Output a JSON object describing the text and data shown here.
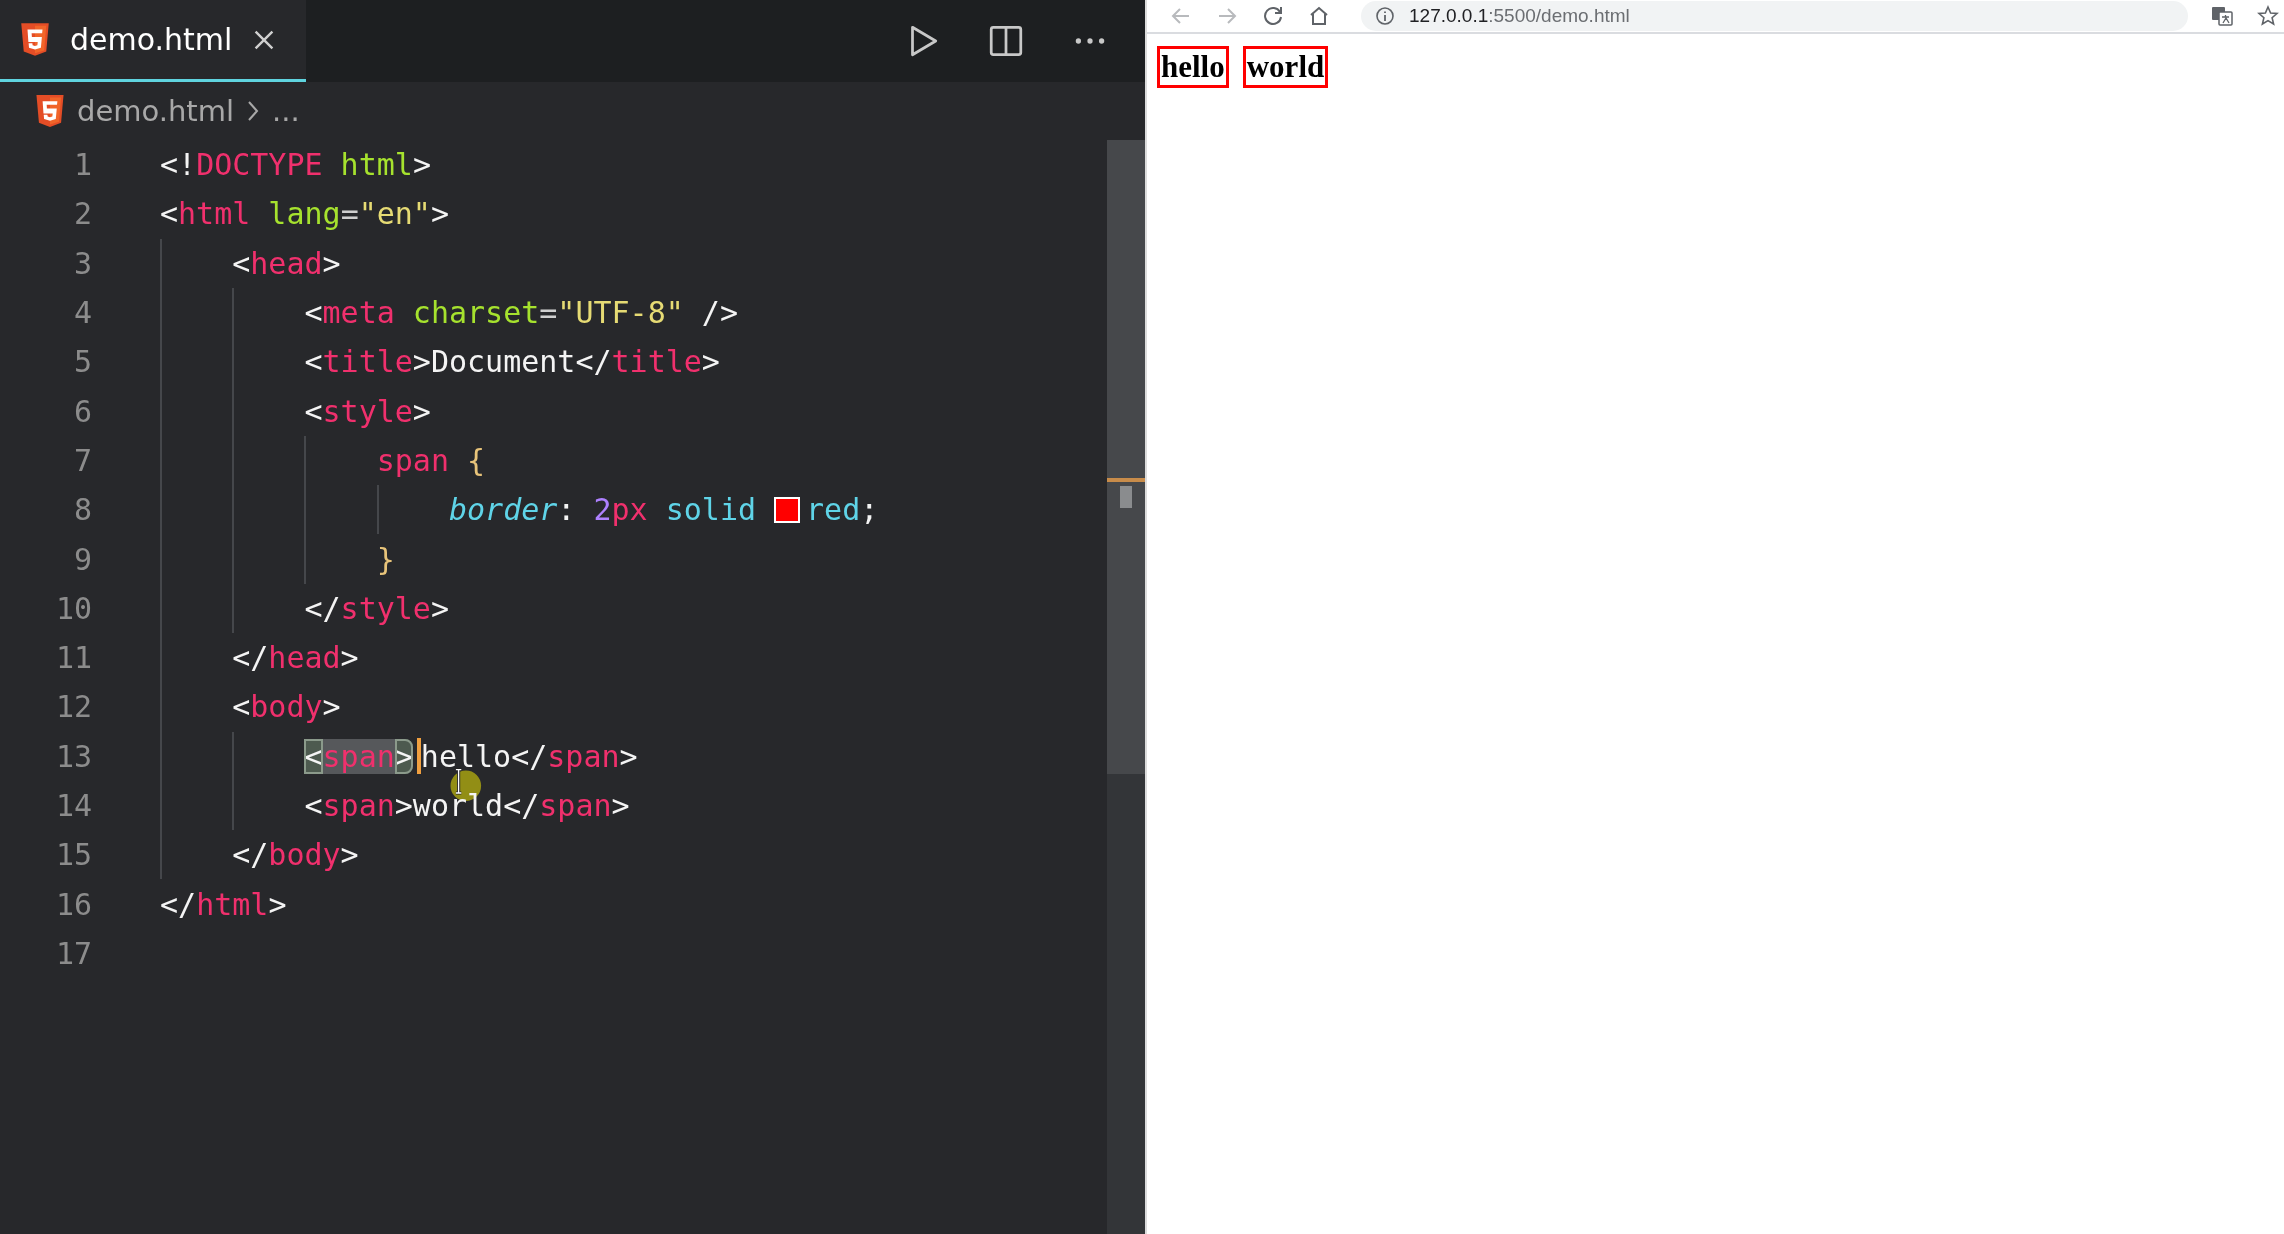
{
  "editor": {
    "tabs": [
      {
        "label": "demo.html",
        "selected": true
      }
    ],
    "breadcrumb": {
      "file": "demo.html",
      "more": "..."
    },
    "lines": [
      {
        "number": "1",
        "tokens": [
          {
            "kind": "punct",
            "text": "<!"
          },
          {
            "kind": "tag",
            "text": "DOCTYPE"
          },
          {
            "kind": "attr",
            "text": " html"
          },
          {
            "kind": "punct",
            "text": ">"
          }
        ]
      },
      {
        "number": "2",
        "tokens": [
          {
            "kind": "punct",
            "text": "<"
          },
          {
            "kind": "tag",
            "text": "html"
          },
          {
            "kind": "attr",
            "text": " lang"
          },
          {
            "kind": "eq",
            "text": "="
          },
          {
            "kind": "string",
            "text": "\"en\""
          },
          {
            "kind": "punct",
            "text": ">"
          }
        ],
        "children": [
          {
            "number": "3",
            "tokens": [
              {
                "kind": "punct",
                "text": "<"
              },
              {
                "kind": "tag",
                "text": "head"
              },
              {
                "kind": "punct",
                "text": ">"
              }
            ],
            "children": [
              {
                "number": "4",
                "tokens": [
                  {
                    "kind": "punct",
                    "text": "<"
                  },
                  {
                    "kind": "tag",
                    "text": "meta"
                  },
                  {
                    "kind": "attr",
                    "text": " charset"
                  },
                  {
                    "kind": "eq",
                    "text": "="
                  },
                  {
                    "kind": "string",
                    "text": "\"UTF-8\""
                  },
                  {
                    "kind": "punct",
                    "text": " />"
                  }
                ]
              },
              {
                "number": "5",
                "tokens": [
                  {
                    "kind": "punct",
                    "text": "<"
                  },
                  {
                    "kind": "tag",
                    "text": "title"
                  },
                  {
                    "kind": "punct",
                    "text": ">"
                  },
                  {
                    "kind": "text",
                    "text": "Document"
                  },
                  {
                    "kind": "punct",
                    "text": "</"
                  },
                  {
                    "kind": "tag",
                    "text": "title"
                  },
                  {
                    "kind": "punct",
                    "text": ">"
                  }
                ]
              },
              {
                "number": "6",
                "tokens": [
                  {
                    "kind": "punct",
                    "text": "<"
                  },
                  {
                    "kind": "tag",
                    "text": "style"
                  },
                  {
                    "kind": "punct",
                    "text": ">"
                  }
                ],
                "children": [
                  {
                    "number": "7",
                    "tokens": [
                      {
                        "kind": "tag",
                        "text": "span"
                      },
                      {
                        "kind": "brace",
                        "text": " {"
                      }
                    ],
                    "children": [
                      {
                        "number": "8",
                        "tokens": [
                          {
                            "kind": "prop",
                            "text": "border"
                          },
                          {
                            "kind": "punct",
                            "text": ": "
                          },
                          {
                            "kind": "num",
                            "text": "2"
                          },
                          {
                            "kind": "tag",
                            "text": "px"
                          },
                          {
                            "kind": "value",
                            "text": " solid"
                          },
                          {
                            "kind": "swatch",
                            "color": "#ff0000"
                          },
                          {
                            "kind": "value",
                            "text": "red"
                          },
                          {
                            "kind": "punct",
                            "text": ";"
                          }
                        ]
                      }
                    ]
                  },
                  {
                    "number": "9",
                    "tokens": [
                      {
                        "kind": "brace",
                        "text": "}"
                      }
                    ]
                  }
                ]
              },
              {
                "number": "10",
                "tokens": [
                  {
                    "kind": "punct",
                    "text": "</"
                  },
                  {
                    "kind": "tag",
                    "text": "style"
                  },
                  {
                    "kind": "punct",
                    "text": ">"
                  }
                ]
              }
            ]
          },
          {
            "number": "11",
            "tokens": [
              {
                "kind": "punct",
                "text": "</"
              },
              {
                "kind": "tag",
                "text": "head"
              },
              {
                "kind": "punct",
                "text": ">"
              }
            ]
          },
          {
            "number": "12",
            "tokens": [
              {
                "kind": "punct",
                "text": "<"
              },
              {
                "kind": "tag",
                "text": "body"
              },
              {
                "kind": "punct",
                "text": ">"
              }
            ],
            "children": [
              {
                "number": "13",
                "tokens": [
                  {
                    "kind": "punct",
                    "text": "<",
                    "selected": true
                  },
                  {
                    "kind": "tag",
                    "text": "span",
                    "selected": true
                  },
                  {
                    "kind": "punct",
                    "text": ">",
                    "selected": true
                  },
                  {
                    "kind": "caret"
                  },
                  {
                    "kind": "text",
                    "text": "hello",
                    "selected": false
                  },
                  {
                    "kind": "punct",
                    "text": "</",
                    "selected": false
                  },
                  {
                    "kind": "tag",
                    "text": "span",
                    "selected": false
                  },
                  {
                    "kind": "punct",
                    "text": ">",
                    "selected": false
                  }
                ]
              },
              {
                "number": "14",
                "tokens": [
                  {
                    "kind": "punct",
                    "text": "<"
                  },
                  {
                    "kind": "tag",
                    "text": "span"
                  },
                  {
                    "kind": "punct",
                    "text": ">"
                  },
                  {
                    "kind": "text",
                    "text": "world"
                  },
                  {
                    "kind": "punct",
                    "text": "</"
                  },
                  {
                    "kind": "tag",
                    "text": "span"
                  },
                  {
                    "kind": "punct",
                    "text": ">"
                  }
                ]
              }
            ]
          },
          {
            "number": "15",
            "tokens": [
              {
                "kind": "punct",
                "text": "</"
              },
              {
                "kind": "tag",
                "text": "body"
              },
              {
                "kind": "punct",
                "text": ">"
              }
            ]
          }
        ]
      },
      {
        "number": "16",
        "tokens": [
          {
            "kind": "punct",
            "text": "</"
          },
          {
            "kind": "tag",
            "text": "html"
          },
          {
            "kind": "punct",
            "text": ">"
          }
        ]
      },
      {
        "number": "17"
      }
    ]
  },
  "browser": {
    "nav": [
      {
        "kind": "back",
        "disabled": true
      },
      {
        "kind": "forward",
        "disabled": true
      },
      {
        "kind": "reload",
        "disabled": false
      },
      {
        "kind": "home",
        "disabled": false
      }
    ],
    "address": {
      "host": "127.0.0.1",
      "path": ":5500/demo.html"
    },
    "page": {
      "spans": [
        "hello",
        "world"
      ]
    }
  }
}
